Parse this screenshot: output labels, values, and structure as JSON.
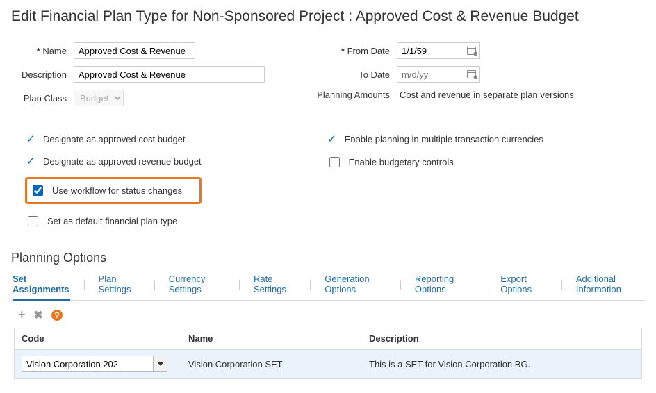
{
  "page": {
    "title": "Edit Financial Plan Type for Non-Sponsored Project :   Approved Cost & Revenue Budget"
  },
  "form": {
    "name_label": "Name",
    "name_value": "Approved Cost & Revenue",
    "desc_label": "Description",
    "desc_value": "Approved Cost & Revenue",
    "plan_class_label": "Plan Class",
    "plan_class_value": "Budget",
    "from_date_label": "From Date",
    "from_date_value": "1/1/59",
    "to_date_label": "To Date",
    "to_date_placeholder": "m/d/yy",
    "planning_amounts_label": "Planning Amounts",
    "planning_amounts_value": "Cost and revenue in separate plan versions"
  },
  "checks": {
    "designate_cost": "Designate as approved cost budget",
    "designate_revenue": "Designate as approved revenue budget",
    "use_workflow": "Use workflow for status changes",
    "set_default": "Set as default financial plan type",
    "enable_multi": "Enable planning in multiple transaction currencies",
    "enable_budgetary": "Enable budgetary controls"
  },
  "planning_options": {
    "heading": "Planning Options",
    "tabs": [
      {
        "label": "Set Assignments",
        "active": true
      },
      {
        "label": "Plan Settings"
      },
      {
        "label": "Currency Settings"
      },
      {
        "label": "Rate Settings"
      },
      {
        "label": "Generation Options"
      },
      {
        "label": "Reporting Options"
      },
      {
        "label": "Export Options"
      },
      {
        "label": "Additional Information"
      }
    ],
    "table": {
      "headers": {
        "code": "Code",
        "name": "Name",
        "description": "Description"
      },
      "rows": [
        {
          "code": "Vision Corporation 202",
          "name": "Vision Corporation SET",
          "description": "This is a SET for Vision Corporation BG."
        }
      ]
    }
  }
}
